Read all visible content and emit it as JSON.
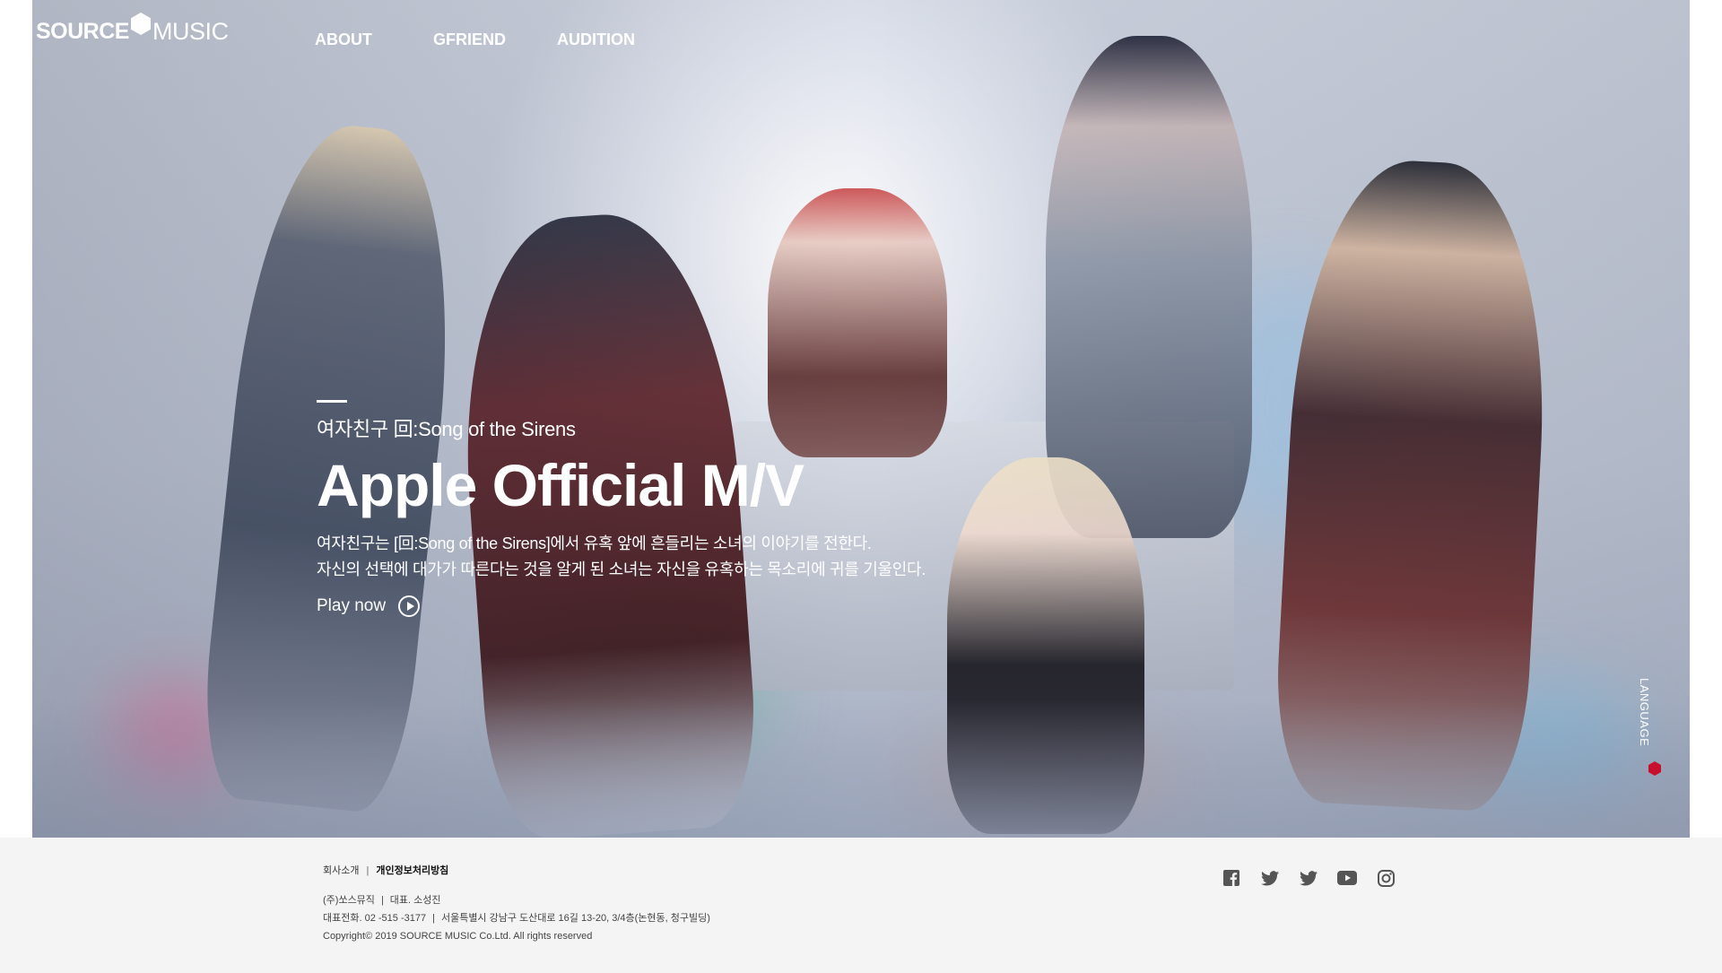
{
  "brand": {
    "logo_part1": "SOURCE",
    "logo_part2": "MUSIC"
  },
  "nav": {
    "items": [
      {
        "label": "ABOUT"
      },
      {
        "label": "GFRIEND"
      },
      {
        "label": "AUDITION"
      }
    ]
  },
  "hero": {
    "subtitle": "여자친구 回:Song of the Sirens",
    "title": "Apple Official M/V",
    "description_line1": "여자친구는 [回:Song of the Sirens]에서 유혹 앞에 흔들리는 소녀의 이야기를 전한다.",
    "description_line2": "자신의 선택에 대가가 따른다는 것을 알게 된 소녀는 자신을 유혹하는 목소리에 귀를 기울인다.",
    "play_label": "Play now",
    "play_icon": "play-circle-icon"
  },
  "language": {
    "label": "LANGUAGE",
    "accent": "#c8102e"
  },
  "footer": {
    "link_company": "회사소개",
    "link_privacy": "개인정보처리방침",
    "company_name": "(주)쏘스뮤직",
    "ceo": "대표. 소성진",
    "phone": "대표전화. 02 -515 -3177",
    "address": "서울특별시 강남구 도산대로 16길 13-20, 3/4층(논현동, 청구빌딩)",
    "copyright": "Copyright© 2019 SOURCE MUSIC Co.Ltd. All rights reserved",
    "social": [
      "facebook-icon",
      "twitter-icon",
      "twitter-icon",
      "youtube-icon",
      "instagram-icon"
    ]
  },
  "colors": {
    "footer_bg": "#f4f4f4",
    "text_white": "#ffffff"
  }
}
